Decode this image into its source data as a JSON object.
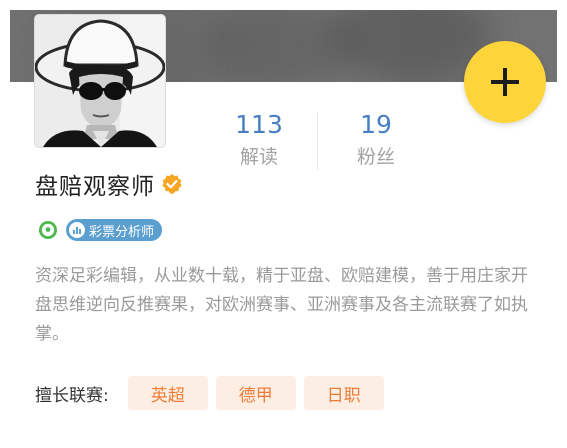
{
  "profile": {
    "name": "盘赔观察师",
    "badge_label": "彩票分析师",
    "bio": "资深足彩编辑，从业数十载，精于亚盘、欧赔建模，善于用庄家开盘思维逆向反推赛果，对欧洲赛事、亚洲赛事及各主流联赛了如执掌。"
  },
  "stats": {
    "reads": {
      "value": "113",
      "label": "解读"
    },
    "fans": {
      "value": "19",
      "label": "粉丝"
    }
  },
  "specialty": {
    "label": "擅长联赛:",
    "tags": [
      "英超",
      "德甲",
      "日职"
    ]
  },
  "colors": {
    "accent_yellow": "#fdd43a",
    "stat_blue": "#4a7ec4",
    "badge_blue": "#5b9fd1",
    "tag_orange": "#ef7d3a",
    "tag_bg": "#fdeee3",
    "verified_orange": "#f5a623",
    "soccer_green": "#4cb84a"
  },
  "icons": {
    "add": "plus-icon",
    "verified": "verified-check-icon",
    "sport": "soccer-ball-icon",
    "analyst": "bar-chart-icon"
  }
}
